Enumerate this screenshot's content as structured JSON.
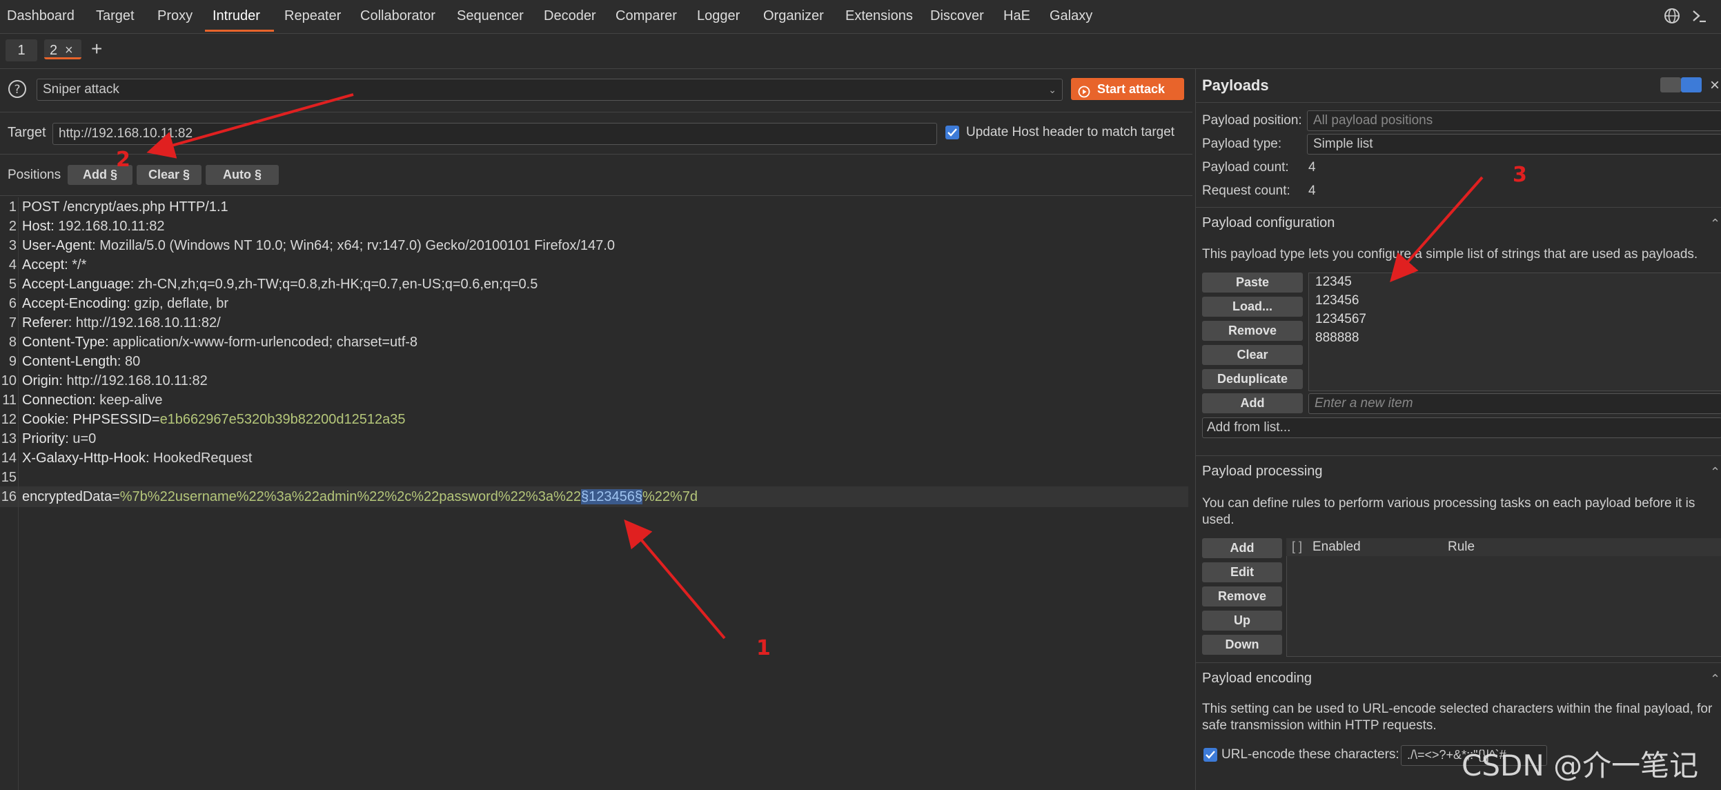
{
  "menu": [
    "Dashboard",
    "Target",
    "Proxy",
    "Intruder",
    "Repeater",
    "Collaborator",
    "Sequencer",
    "Decoder",
    "Comparer",
    "Logger",
    "Organizer",
    "Extensions",
    "Discover",
    "HaE",
    "Galaxy"
  ],
  "tabs": [
    "1",
    "2"
  ],
  "attack": {
    "type": "Sniper attack",
    "start_label": "Start attack",
    "target_label": "Target",
    "target_value": "http://192.168.10.11:82",
    "update_host_label": "Update Host header to match target"
  },
  "positions": {
    "label": "Positions",
    "add": "Add §",
    "clear": "Clear §",
    "auto": "Auto §"
  },
  "request": {
    "l1": "POST /encrypt/aes.php HTTP/1.1",
    "l2n": "Host",
    "l2v": " 192.168.10.11:82",
    "l3n": "User-Agent",
    "l3v": " Mozilla/5.0 (Windows NT 10.0; Win64; x64; rv:147.0) Gecko/20100101 Firefox/147.0",
    "l4n": "Accept",
    "l4v": " */*",
    "l5n": "Accept-Language",
    "l5v": " zh-CN,zh;q=0.9,zh-TW;q=0.8,zh-HK;q=0.7,en-US;q=0.6,en;q=0.5",
    "l6n": "Accept-Encoding",
    "l6v": " gzip, deflate, br",
    "l7n": "Referer",
    "l7v": " http://192.168.10.11:82/",
    "l8n": "Content-Type",
    "l8v": " application/x-www-form-urlencoded; charset=utf-8",
    "l9n": "Content-Length",
    "l9v": " 80",
    "l10n": "Origin",
    "l10v": " http://192.168.10.11:82",
    "l11n": "Connection",
    "l11v": " keep-alive",
    "l12n": "Cookie",
    "l12a": " PHPSESSID",
    "l12v": "e1b662967e5320b39b82200d12512a35",
    "l13n": "Priority",
    "l13v": " u=0",
    "l14n": "X-Galaxy-Http-Hook",
    "l14v": " HookedRequest",
    "l16n": "encryptedData",
    "l16a": "%7b%22username%22%3a%22admin%22%2c%22password%22%3a%22",
    "l16m": "§123456§",
    "l16b": "%22%7d"
  },
  "payloads": {
    "title": "Payloads",
    "position_label": "Payload position:",
    "position_value": "All payload positions",
    "type_label": "Payload type:",
    "type_value": "Simple list",
    "count_label": "Payload count:",
    "count_value": "4",
    "request_label": "Request count:",
    "request_value": "4",
    "config_head": "Payload configuration",
    "config_desc": "This payload type lets you configure a simple list of strings that are used as payloads.",
    "btn_paste": "Paste",
    "btn_load": "Load...",
    "btn_remove": "Remove",
    "btn_clear": "Clear",
    "btn_dedup": "Deduplicate",
    "btn_add": "Add",
    "items": [
      "12345",
      "123456",
      "1234567",
      "888888"
    ],
    "new_item_placeholder": "Enter a new item",
    "add_from_list": "Add from list...",
    "processing_head": "Payload processing",
    "processing_desc": "You can define rules to perform various processing tasks on each payload before it is used.",
    "proc_add": "Add",
    "proc_edit": "Edit",
    "proc_remove": "Remove",
    "proc_up": "Up",
    "proc_down": "Down",
    "col_enabled": "Enabled",
    "col_rule": "Rule",
    "encoding_head": "Payload encoding",
    "encoding_desc": "This setting can be used to URL-encode selected characters within the final payload, for safe transmission within HTTP requests.",
    "urlencode_label": "URL-encode these characters:",
    "urlencode_value": "./\\=<>?+&*;:\"{}|^`#"
  },
  "annotations": [
    "1",
    "2",
    "3"
  ],
  "watermark": "CSDN @介一笔记",
  "colors": {
    "accent": "#e8642b",
    "annotation": "#e02020",
    "marker": "#3b5a8c"
  }
}
